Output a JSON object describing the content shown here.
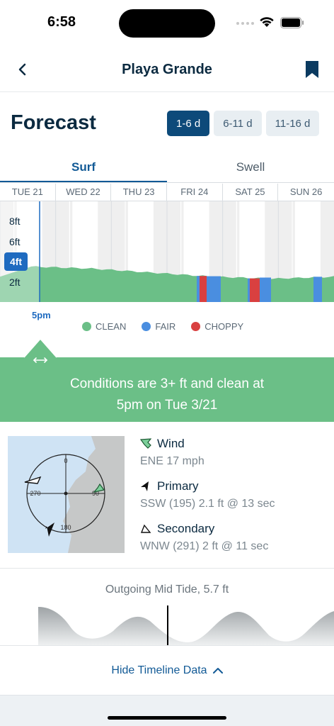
{
  "status_bar": {
    "time": "6:58"
  },
  "nav": {
    "title": "Playa Grande"
  },
  "forecast": {
    "title": "Forecast",
    "ranges": [
      "1-6 d",
      "6-11 d",
      "11-16 d"
    ],
    "active_range": "1-6 d"
  },
  "view_tabs": {
    "surf": "Surf",
    "swell": "Swell",
    "active": "Surf"
  },
  "days": [
    "TUE 21",
    "WED 22",
    "THU 23",
    "FRI 24",
    "SAT 25",
    "SUN 26"
  ],
  "chart": {
    "y_labels": [
      "8ft",
      "6ft",
      "4ft",
      "2ft"
    ],
    "active_y_label": "4ft",
    "time_marker": "5pm",
    "legend": [
      {
        "label": "CLEAN",
        "color": "#6bbf87"
      },
      {
        "label": "FAIR",
        "color": "#4a8ee0"
      },
      {
        "label": "CHOPPY",
        "color": "#d94040"
      }
    ]
  },
  "chart_data": {
    "type": "area",
    "x": [
      "TUE 21",
      "WED 22",
      "THU 23",
      "FRI 24",
      "SAT 25",
      "SUN 26"
    ],
    "series": [
      {
        "name": "",
        "values": [
          3.5,
          3.3,
          2.9,
          2.5,
          2.3,
          2.5
        ]
      }
    ],
    "y_tick_labels": [
      "2ft",
      "4ft",
      "6ft",
      "8ft"
    ],
    "condition_categories": [
      "CLEAN",
      "FAIR",
      "CHOPPY"
    ],
    "legend_position": "bottom"
  },
  "banner": {
    "line1": "Conditions are 3+ ft and clean at",
    "line2": "5pm on Tue 3/21"
  },
  "compass": {
    "n": "0",
    "e": "90",
    "s": "180",
    "w": "270"
  },
  "wind": {
    "label": "Wind",
    "value": "ENE 17 mph"
  },
  "primary": {
    "label": "Primary",
    "value": "SSW (195) 2.1 ft @ 13 sec"
  },
  "secondary": {
    "label": "Secondary",
    "value": "WNW (291) 2 ft @ 11 sec"
  },
  "tide": {
    "title": "Outgoing Mid Tide,  5.7 ft"
  },
  "hide_timeline": {
    "label": "Hide Timeline Data"
  }
}
